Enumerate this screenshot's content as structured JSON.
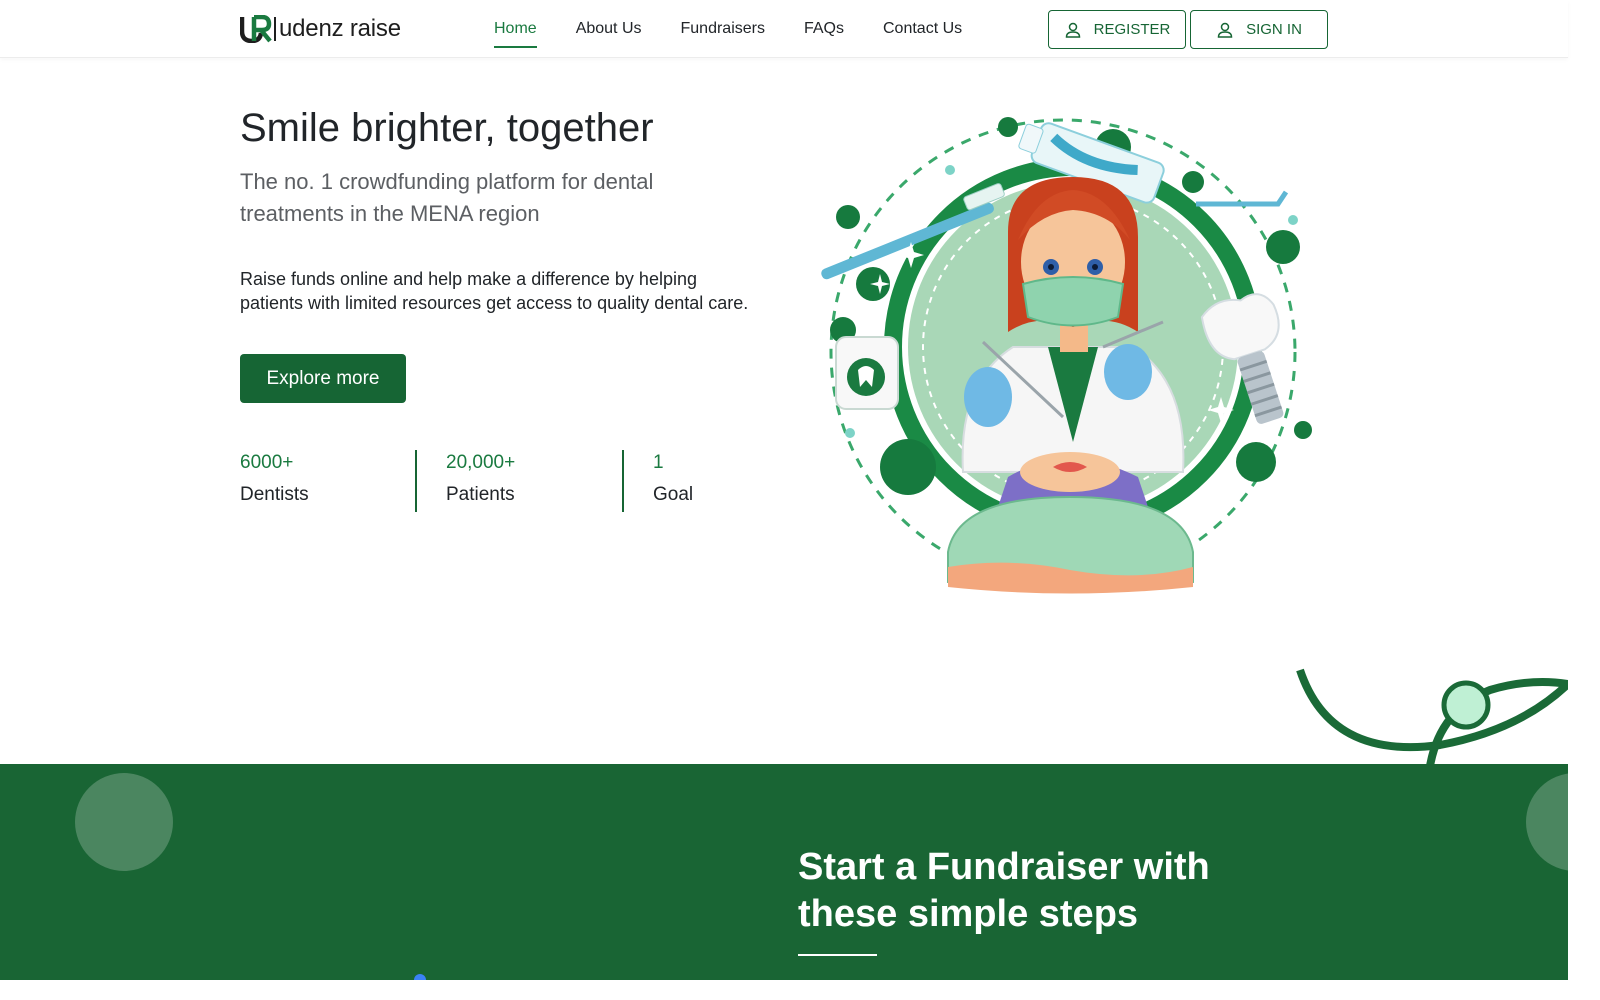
{
  "brand": {
    "name": "udenz raise",
    "accent": "#166534",
    "accent_light": "#1a7a40"
  },
  "nav": {
    "items": [
      {
        "label": "Home",
        "active": true
      },
      {
        "label": "About Us",
        "active": false
      },
      {
        "label": "Fundraisers",
        "active": false
      },
      {
        "label": "FAQs",
        "active": false
      },
      {
        "label": "Contact Us",
        "active": false
      }
    ],
    "register_label": "REGISTER",
    "signin_label": "SIGN IN"
  },
  "hero": {
    "title": "Smile brighter, together",
    "subtitle": "The no. 1 crowdfunding platform for dental treatments in the MENA region",
    "description": "Raise funds online and help make a difference by helping patients with limited resources get access to quality dental care.",
    "cta_label": "Explore more",
    "stats": [
      {
        "value": "6000+",
        "label": "Dentists"
      },
      {
        "value": "20,000+",
        "label": "Patients"
      },
      {
        "value": "1",
        "label": "Goal"
      }
    ]
  },
  "steps_section": {
    "title": "Start a Fundraiser with these simple steps",
    "background": "#196534"
  },
  "icons": {
    "user": "user-icon",
    "logo": "logo-icon"
  }
}
